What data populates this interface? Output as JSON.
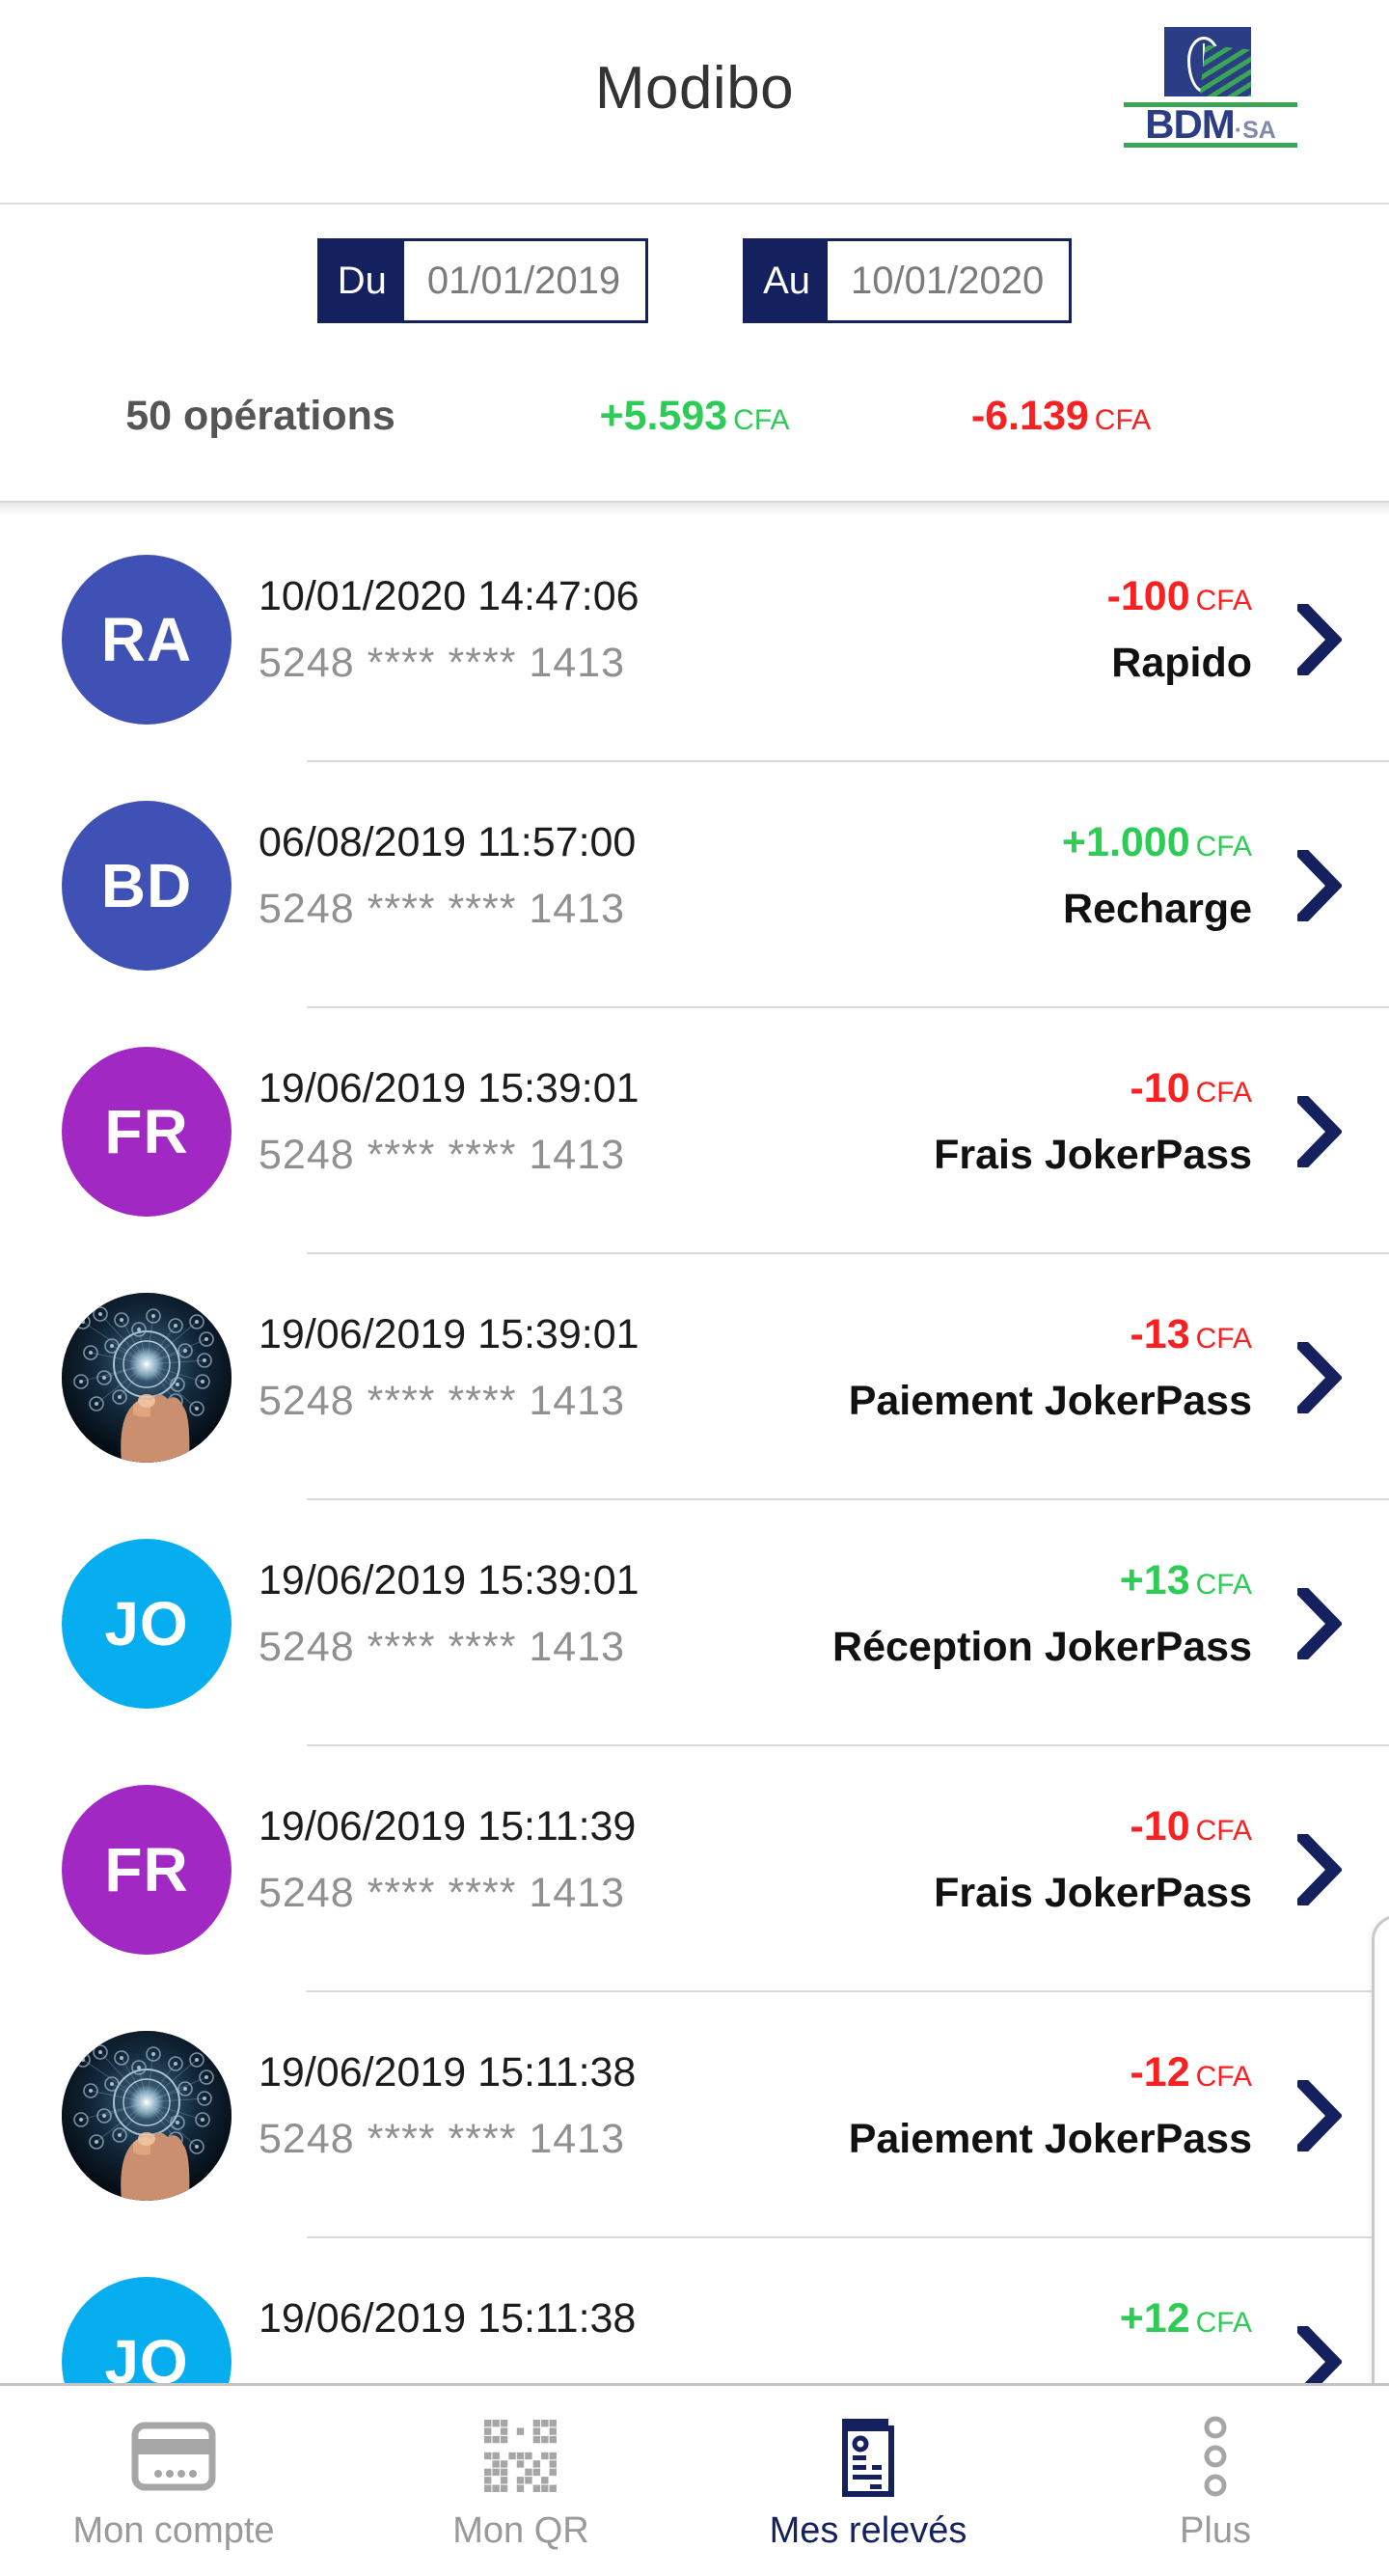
{
  "header": {
    "title": "Modibo",
    "logo": {
      "name": "BDM",
      "suffix": "·SA"
    }
  },
  "filter": {
    "from_label": "Du",
    "from_value": "01/01/2019",
    "to_label": "Au",
    "to_value": "10/01/2020",
    "operations_count": "50 opérations",
    "credit_total": "+5.593",
    "credit_currency": "CFA",
    "debit_total": "-6.139",
    "debit_currency": "CFA"
  },
  "transactions": [
    {
      "initials": "RA",
      "avatar_type": "initials",
      "avatar_color": "#3f51b5",
      "date": "10/01/2020 14:47:06",
      "card": "5248 **** **** 1413",
      "amount": "-100",
      "currency": "CFA",
      "sign": "neg",
      "label": "Rapido"
    },
    {
      "initials": "BD",
      "avatar_type": "initials",
      "avatar_color": "#3f51b5",
      "date": "06/08/2019 11:57:00",
      "card": "5248 **** **** 1413",
      "amount": "+1.000",
      "currency": "CFA",
      "sign": "pos",
      "label": "Recharge"
    },
    {
      "initials": "FR",
      "avatar_type": "initials",
      "avatar_color": "#a228c4",
      "date": "19/06/2019 15:39:01",
      "card": "5248 **** **** 1413",
      "amount": "-10",
      "currency": "CFA",
      "sign": "neg",
      "label": "Frais JokerPass"
    },
    {
      "initials": "",
      "avatar_type": "photo",
      "avatar_color": "#0a1622",
      "date": "19/06/2019 15:39:01",
      "card": "5248 **** **** 1413",
      "amount": "-13",
      "currency": "CFA",
      "sign": "neg",
      "label": "Paiement JokerPass"
    },
    {
      "initials": "JO",
      "avatar_type": "initials",
      "avatar_color": "#06aeef",
      "date": "19/06/2019 15:39:01",
      "card": "5248 **** **** 1413",
      "amount": "+13",
      "currency": "CFA",
      "sign": "pos",
      "label": "Réception JokerPass"
    },
    {
      "initials": "FR",
      "avatar_type": "initials",
      "avatar_color": "#a228c4",
      "date": "19/06/2019 15:11:39",
      "card": "5248 **** **** 1413",
      "amount": "-10",
      "currency": "CFA",
      "sign": "neg",
      "label": "Frais JokerPass"
    },
    {
      "initials": "",
      "avatar_type": "photo",
      "avatar_color": "#0a1622",
      "date": "19/06/2019 15:11:38",
      "card": "5248 **** **** 1413",
      "amount": "-12",
      "currency": "CFA",
      "sign": "neg",
      "label": "Paiement JokerPass"
    },
    {
      "initials": "JO",
      "avatar_type": "initials",
      "avatar_color": "#06aeef",
      "date": "19/06/2019 15:11:38",
      "card": "",
      "amount": "+12",
      "currency": "CFA",
      "sign": "pos",
      "label": ""
    }
  ],
  "bottom_nav": [
    {
      "label": "Mon compte",
      "icon": "credit-card-icon",
      "active": false
    },
    {
      "label": "Mon QR",
      "icon": "qr-code-icon",
      "active": false
    },
    {
      "label": "Mes relevés",
      "icon": "receipt-icon",
      "active": true
    },
    {
      "label": "Plus",
      "icon": "more-vertical-icon",
      "active": false
    }
  ],
  "colors": {
    "navy": "#14215e",
    "green": "#2ecc56",
    "red": "#f82020",
    "grey": "#9a9a9a"
  }
}
